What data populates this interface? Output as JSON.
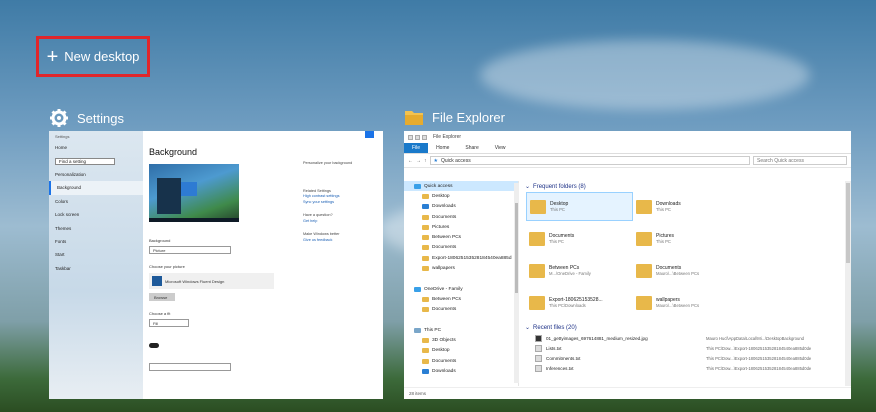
{
  "new_desktop": {
    "label": "New desktop",
    "icon": "plus-icon"
  },
  "windows": [
    {
      "title": "Settings",
      "icon": "gear-icon"
    },
    {
      "title": "File Explorer",
      "icon": "folder-icon"
    }
  ],
  "settings": {
    "heading": "Background",
    "nav": [
      "Home",
      "Find a setting",
      "Personalization",
      "Background",
      "Colors",
      "Lock screen",
      "Themes",
      "Fonts",
      "Start",
      "Taskbar"
    ],
    "background_label": "Background",
    "background_value": "Picture",
    "choose_picture_label": "Choose your picture",
    "picture_name": "Microsoft Windows Fluent Design",
    "browse_label": "Browse",
    "fit_label": "Choose a fit",
    "fit_value": "Fill",
    "right_title": "Personalize your background",
    "right_links": [
      "Related Settings",
      "High contrast settings",
      "Sync your settings",
      "Have a question?",
      "Get help",
      "Make Windows better",
      "Give us feedback"
    ]
  },
  "explorer": {
    "title_bar": "File Explorer",
    "menu": [
      "File",
      "Home",
      "Share",
      "View"
    ],
    "address": "Quick access",
    "search_placeholder": "Search Quick access",
    "nav": [
      {
        "label": "Quick access",
        "icon": "star-icon",
        "sel": true
      },
      {
        "label": "Desktop",
        "icon": "folder-icon"
      },
      {
        "label": "Downloads",
        "icon": "download-icon"
      },
      {
        "label": "Documents",
        "icon": "folder-icon"
      },
      {
        "label": "Pictures",
        "icon": "folder-icon"
      },
      {
        "label": "Between PCs",
        "icon": "folder-icon"
      },
      {
        "label": "Documents",
        "icon": "folder-icon"
      },
      {
        "label": "Export-1806251535281845​40ea885d",
        "icon": "folder-icon"
      },
      {
        "label": "wallpapers",
        "icon": "folder-icon"
      },
      {
        "label": "",
        "icon": ""
      },
      {
        "label": "OneDrive - Family",
        "icon": "cloud-icon"
      },
      {
        "label": "Between PCs",
        "icon": "folder-icon"
      },
      {
        "label": "Documents",
        "icon": "folder-icon"
      },
      {
        "label": "",
        "icon": ""
      },
      {
        "label": "This PC",
        "icon": "pc-icon"
      },
      {
        "label": "3D Objects",
        "icon": "folder-icon"
      },
      {
        "label": "Desktop",
        "icon": "folder-icon"
      },
      {
        "label": "Documents",
        "icon": "folder-icon"
      },
      {
        "label": "Downloads",
        "icon": "download-icon"
      }
    ],
    "frequent_header": "Frequent folders (8)",
    "folders": [
      {
        "name": "Desktop",
        "sub": "This PC"
      },
      {
        "name": "Downloads",
        "sub": "This PC"
      },
      {
        "name": "Documents",
        "sub": "This PC"
      },
      {
        "name": "Pictures",
        "sub": "This PC"
      },
      {
        "name": "Between PCs",
        "sub": "M...\\OneDrive - Family"
      },
      {
        "name": "Documents",
        "sub": "Mauro\\...\\Between PCs"
      },
      {
        "name": "Export-180625153528...",
        "sub": "This PC\\Downloads"
      },
      {
        "name": "wallpapers",
        "sub": "Mauro\\...\\Between PCs"
      }
    ],
    "recent_header": "Recent files (20)",
    "recent": [
      {
        "name": "01_gettyimages_697614881_medium_resized.jpg",
        "path": "Mauro Hucl\\AppData\\Local\\Mi...\\DesktopBackground"
      },
      {
        "name": "Lists.txt",
        "path": "This PC\\Dow...\\Export-18062515352818454​0ea885d0de"
      },
      {
        "name": "Commitments.txt",
        "path": "This PC\\Dow...\\Export-18062515352818454​0ea885d0de"
      },
      {
        "name": "Inferences.txt",
        "path": "This PC\\Dow...\\Export-18062515352818454​0ea885d0de"
      }
    ],
    "status": "28 items"
  }
}
